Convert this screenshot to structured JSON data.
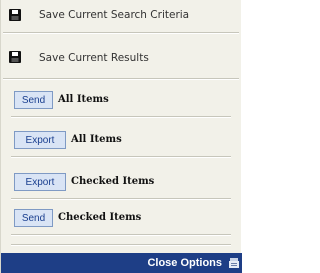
{
  "menu": {
    "save_criteria": {
      "label": "Save Current Search Criteria",
      "icon": "floppy-disk-icon"
    },
    "save_results": {
      "label": "Save Current Results",
      "icon": "floppy-disk-icon"
    },
    "send_all": {
      "button": "Send",
      "label": "All Items"
    },
    "export_all": {
      "button": "Export",
      "label": "All Items"
    },
    "export_checked": {
      "button": "Export",
      "label": "Checked Items"
    },
    "send_checked": {
      "button": "Send",
      "label": "Checked Items"
    }
  },
  "footer": {
    "label": "Close Options",
    "icon": "close-options-icon",
    "background": "#1e3e86"
  }
}
